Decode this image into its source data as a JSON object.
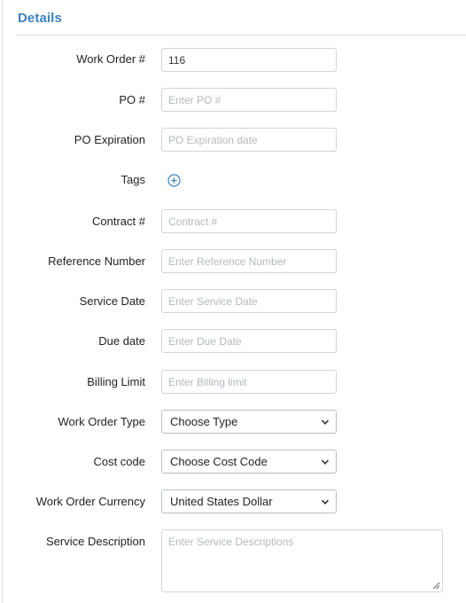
{
  "section": {
    "title": "Details"
  },
  "fields": {
    "work_order": {
      "label": "Work Order #",
      "value": "116",
      "placeholder": ""
    },
    "po": {
      "label": "PO #",
      "value": "",
      "placeholder": "Enter PO #"
    },
    "po_expiration": {
      "label": "PO Expiration",
      "value": "",
      "placeholder": "PO Expiration date"
    },
    "tags": {
      "label": "Tags",
      "icon": "plus-circle-icon"
    },
    "contract": {
      "label": "Contract #",
      "value": "",
      "placeholder": "Contract #"
    },
    "reference_number": {
      "label": "Reference Number",
      "value": "",
      "placeholder": "Enter Reference Number"
    },
    "service_date": {
      "label": "Service Date",
      "value": "",
      "placeholder": "Enter Service Date"
    },
    "due_date": {
      "label": "Due date",
      "value": "",
      "placeholder": "Enter Due Date"
    },
    "billing_limit": {
      "label": "Billing Limit",
      "value": "",
      "placeholder": "Enter Billing limit"
    },
    "work_order_type": {
      "label": "Work Order Type",
      "selected": "Choose Type"
    },
    "cost_code": {
      "label": "Cost code",
      "selected": "Choose Cost Code"
    },
    "work_order_currency": {
      "label": "Work Order Currency",
      "selected": "United States Dollar"
    },
    "service_description": {
      "label": "Service Description",
      "placeholder": "Enter Service Descriptions"
    }
  },
  "colors": {
    "accent": "#3b82c4",
    "border": "#cfd4da",
    "label": "#222222",
    "placeholder": "#b4b9bf"
  }
}
